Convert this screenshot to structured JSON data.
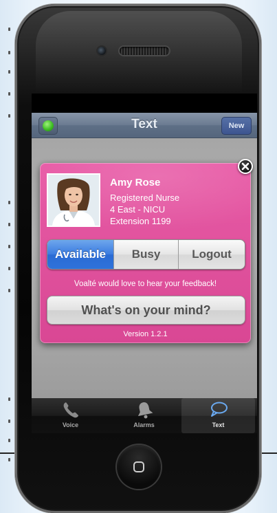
{
  "nav": {
    "title": "Text",
    "new_label": "New"
  },
  "profile": {
    "name": "Amy Rose",
    "role": "Registered Nurse",
    "unit": "4 East - NICU",
    "extension": "Extension 1199"
  },
  "presence": {
    "options": [
      "Available",
      "Busy",
      "Logout"
    ],
    "selected": "Available"
  },
  "feedback": {
    "prompt": "Voalté would love to hear your feedback!",
    "button_label": "What's on your mind?"
  },
  "version": "Version 1.2.1",
  "tabs": [
    {
      "label": "Voice",
      "icon": "phone-icon",
      "active": false
    },
    {
      "label": "Alarms",
      "icon": "bell-icon",
      "active": false
    },
    {
      "label": "Text",
      "icon": "speech-bubble-icon",
      "active": true
    }
  ],
  "colors": {
    "popup_pink": "#e0529d",
    "selected_blue": "#3b7ce0",
    "status_green": "#3fbf24"
  }
}
